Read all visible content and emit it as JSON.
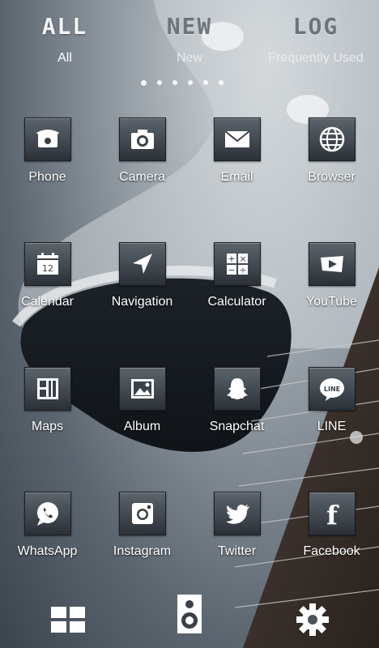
{
  "tabs": [
    {
      "big": "ALL",
      "small": "All",
      "active": true
    },
    {
      "big": "NEW",
      "small": "New",
      "active": false
    },
    {
      "big": "LOG",
      "small": "Frequently Used",
      "active": false
    }
  ],
  "page_dots": 6,
  "apps": [
    {
      "label": "Phone",
      "icon": "phone-icon"
    },
    {
      "label": "Camera",
      "icon": "camera-icon"
    },
    {
      "label": "Email",
      "icon": "email-icon"
    },
    {
      "label": "Browser",
      "icon": "globe-icon"
    },
    {
      "label": "Calendar",
      "icon": "calendar-icon",
      "icon_text": "12"
    },
    {
      "label": "Navigation",
      "icon": "navigation-arrow-icon"
    },
    {
      "label": "Calculator",
      "icon": "calculator-icon",
      "icon_text": "+ × − ÷"
    },
    {
      "label": "YouTube",
      "icon": "youtube-play-icon"
    },
    {
      "label": "Maps",
      "icon": "maps-icon"
    },
    {
      "label": "Album",
      "icon": "album-photo-icon"
    },
    {
      "label": "Snapchat",
      "icon": "snapchat-ghost-icon"
    },
    {
      "label": "LINE",
      "icon": "line-icon",
      "icon_text": "LINE"
    },
    {
      "label": "WhatsApp",
      "icon": "whatsapp-icon"
    },
    {
      "label": "Instagram",
      "icon": "instagram-icon"
    },
    {
      "label": "Twitter",
      "icon": "twitter-bird-icon"
    },
    {
      "label": "Facebook",
      "icon": "facebook-icon",
      "icon_text": "f"
    }
  ],
  "dock": [
    {
      "icon": "grid-icon"
    },
    {
      "icon": "speaker-icon"
    },
    {
      "icon": "gear-icon"
    }
  ]
}
